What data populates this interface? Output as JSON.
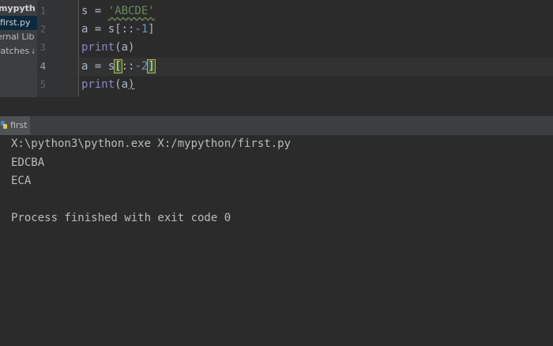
{
  "sidebar": {
    "items": [
      {
        "label": "mypython"
      },
      {
        "label": "first.py"
      },
      {
        "label": "ernal Libr"
      },
      {
        "label": "ratches ar"
      }
    ]
  },
  "editor": {
    "line_numbers": [
      "1",
      "2",
      "3",
      "4",
      "5"
    ],
    "lines": {
      "l1": {
        "pre": "s = ",
        "str": "'ABCDE'"
      },
      "l2": {
        "pre": "a = s[::",
        "num": "-1",
        "post": "]"
      },
      "l3": {
        "fn": "print",
        "post": "(a)"
      },
      "l4": {
        "pre": "a = s",
        "br_open": "[",
        "mid": "::",
        "num": "-2",
        "br_close": "]"
      },
      "l5": {
        "fn": "print",
        "post_a": "(a",
        "post_b": ")"
      }
    }
  },
  "run_tab": {
    "label": "first"
  },
  "console": {
    "lines": [
      "X:\\python3\\python.exe X:/mypython/first.py",
      "EDCBA",
      "ECA",
      "",
      "Process finished with exit code 0"
    ]
  },
  "colors": {
    "background": "#2b2b2b",
    "string": "#6a8759",
    "number": "#6897bb",
    "builtin": "#8888c6",
    "text": "#a9b7c6"
  }
}
